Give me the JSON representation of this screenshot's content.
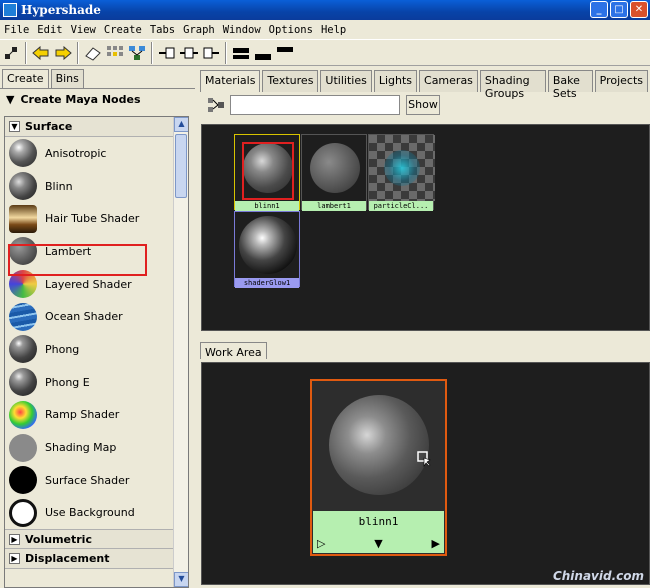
{
  "window": {
    "title": "Hypershade",
    "minimize": "_",
    "maximize": "□",
    "close": "✕"
  },
  "menu": [
    "File",
    "Edit",
    "View",
    "Create",
    "Tabs",
    "Graph",
    "Window",
    "Options",
    "Help"
  ],
  "left_panel": {
    "tabs": [
      "Create",
      "Bins"
    ],
    "header": "Create Maya Nodes",
    "section": "Surface",
    "section_toggle": "▼",
    "items": [
      {
        "label": "Anisotropic"
      },
      {
        "label": "Blinn"
      },
      {
        "label": "Hair Tube Shader"
      },
      {
        "label": "Lambert"
      },
      {
        "label": "Layered Shader"
      },
      {
        "label": "Ocean Shader"
      },
      {
        "label": "Phong"
      },
      {
        "label": "Phong E"
      },
      {
        "label": "Ramp Shader"
      },
      {
        "label": "Shading Map"
      },
      {
        "label": "Surface Shader"
      },
      {
        "label": "Use Background"
      }
    ],
    "collapsed_sections": [
      "Volumetric",
      "Displacement"
    ],
    "collapsed_toggle": "▶"
  },
  "right_panel": {
    "tabs": [
      "Materials",
      "Textures",
      "Utilities",
      "Lights",
      "Cameras",
      "Shading Groups",
      "Bake Sets",
      "Projects"
    ],
    "search": {
      "value": "",
      "show_label": "Show"
    },
    "materials": [
      {
        "label": "blinn1"
      },
      {
        "label": "lambert1"
      },
      {
        "label": "particleCl..."
      },
      {
        "label": "shaderGlow1"
      }
    ],
    "work_tab": "Work Area",
    "work_node": {
      "label": "blinn1",
      "left_ctrl": "▷",
      "mid_ctrl": "▼",
      "right_ctrl": "▶"
    }
  },
  "watermark": "Chinavid.com"
}
